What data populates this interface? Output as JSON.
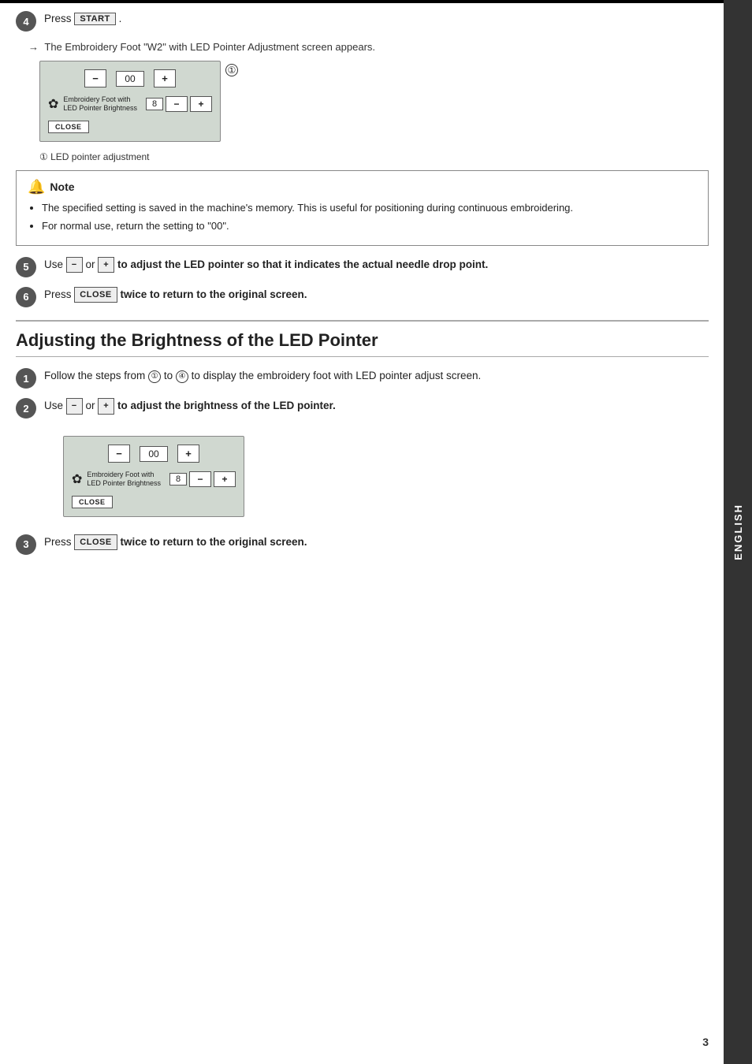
{
  "page": {
    "number": "3",
    "sidebar_label": "ENGLISH"
  },
  "section_upper": {
    "steps": [
      {
        "num": "4",
        "press_label": "Press",
        "btn_label": "START",
        "arrow_text": "The Embroidery Foot \"W2\" with LED Pointer Adjustment screen appears.",
        "annotation_num": "①",
        "annotation_text": "LED pointer adjustment"
      },
      {
        "num": "5",
        "text_before": "Use",
        "minus_label": "−",
        "or_text": "or",
        "plus_label": "+",
        "text_after": "to adjust the LED pointer so that it indicates the actual needle drop point."
      },
      {
        "num": "6",
        "text_before": "Press",
        "btn_label": "CLOSE",
        "text_after": "twice to return to the original screen."
      }
    ],
    "note": {
      "title": "Note",
      "items": [
        "The specified setting is saved in the machine's memory. This is useful for positioning during continuous embroidering.",
        "For normal use, return the setting to \"00\"."
      ]
    }
  },
  "lcd_upper": {
    "minus_btn": "−",
    "display_val": "00",
    "plus_btn": "+",
    "row2_label_line1": "Embroidery Foot with",
    "row2_label_line2": "LED Pointer Brightness",
    "small_val": "8",
    "minus_small": "−",
    "plus_small": "+",
    "close_btn": "CLOSE"
  },
  "lcd_lower": {
    "minus_btn": "−",
    "display_val": "00",
    "plus_btn": "+",
    "row2_label_line1": "Embroidery Foot with",
    "row2_label_line2": "LED Pointer Brightness",
    "small_val": "8",
    "minus_small": "−",
    "plus_small": "+",
    "close_btn": "CLOSE"
  },
  "section_lower": {
    "heading": "Adjusting the Brightness of the LED Pointer",
    "steps": [
      {
        "num": "1",
        "text": "Follow the steps from ① to ④ to display the embroidery foot with LED pointer adjust screen."
      },
      {
        "num": "2",
        "text_before": "Use",
        "minus_label": "−",
        "or_text": "or",
        "plus_label": "+",
        "text_after": "to adjust the brightness of the LED pointer."
      },
      {
        "num": "3",
        "text_before": "Press",
        "btn_label": "CLOSE",
        "text_after": "twice to return to the original screen."
      }
    ]
  }
}
